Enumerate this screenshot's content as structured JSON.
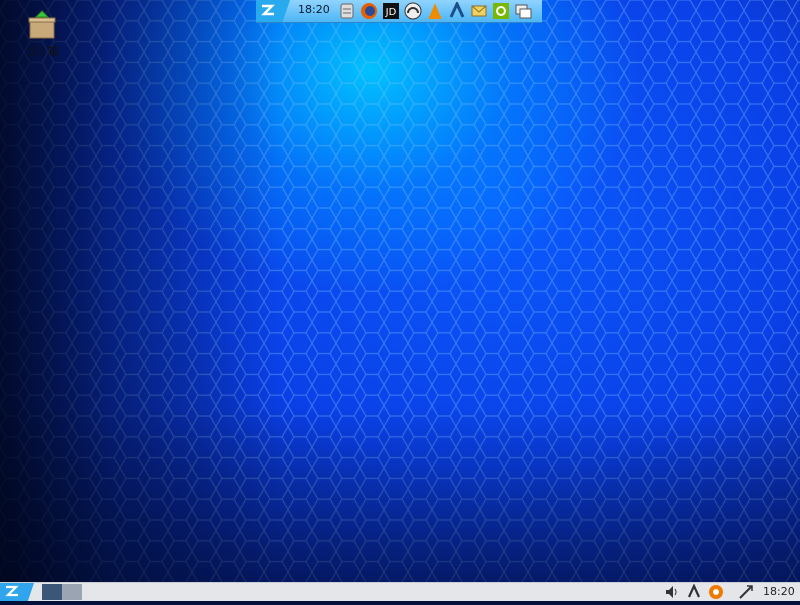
{
  "desktop": {
    "icons": [
      {
        "label": "ゴミ箱",
        "icon": "trash-icon"
      }
    ]
  },
  "dock": {
    "time": "18:20",
    "apps": [
      "zorin-menu-icon",
      "archive-icon",
      "firefox-icon",
      "jd-icon",
      "headphones-icon",
      "vlc-icon",
      "steam-icon",
      "mail-icon",
      "nvidia-icon",
      "window-icon"
    ]
  },
  "panel": {
    "time": "18:20",
    "tray": [
      "volume-icon",
      "steam-icon",
      "updates-icon",
      "network-icon"
    ]
  },
  "colors": {
    "wallpaper_bright": "#00c8ff",
    "wallpaper_mid": "#0a3fe6",
    "panel": "#e4e6ea",
    "zorin_blue": "#2ea5ec"
  }
}
